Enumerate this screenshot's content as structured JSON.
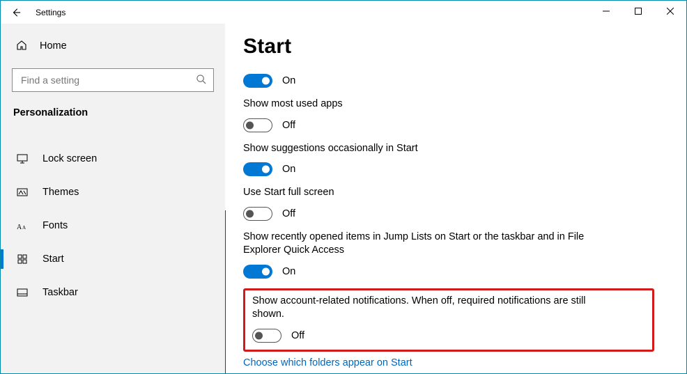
{
  "window": {
    "title": "Settings"
  },
  "sidebar": {
    "home_label": "Home",
    "search_placeholder": "Find a setting",
    "category": "Personalization",
    "items": [
      {
        "label": "Lock screen",
        "icon": "monitor-icon"
      },
      {
        "label": "Themes",
        "icon": "pencil-icon"
      },
      {
        "label": "Fonts",
        "icon": "font-icon"
      },
      {
        "label": "Start",
        "icon": "start-icon",
        "selected": true
      },
      {
        "label": "Taskbar",
        "icon": "taskbar-icon"
      }
    ]
  },
  "page": {
    "title": "Start",
    "on": "On",
    "off": "Off",
    "options": [
      {
        "label_hidden_first": true,
        "state": "on"
      },
      {
        "label": "Show most used apps",
        "state": "off"
      },
      {
        "label": "Show suggestions occasionally in Start",
        "state": "on"
      },
      {
        "label": "Use Start full screen",
        "state": "off"
      },
      {
        "label": "Show recently opened items in Jump Lists on Start or the taskbar and in File Explorer Quick Access",
        "state": "on"
      },
      {
        "label": "Show account-related notifications. When off, required notifications are still shown.",
        "state": "off",
        "highlighted": true
      }
    ],
    "link": "Choose which folders appear on Start"
  }
}
